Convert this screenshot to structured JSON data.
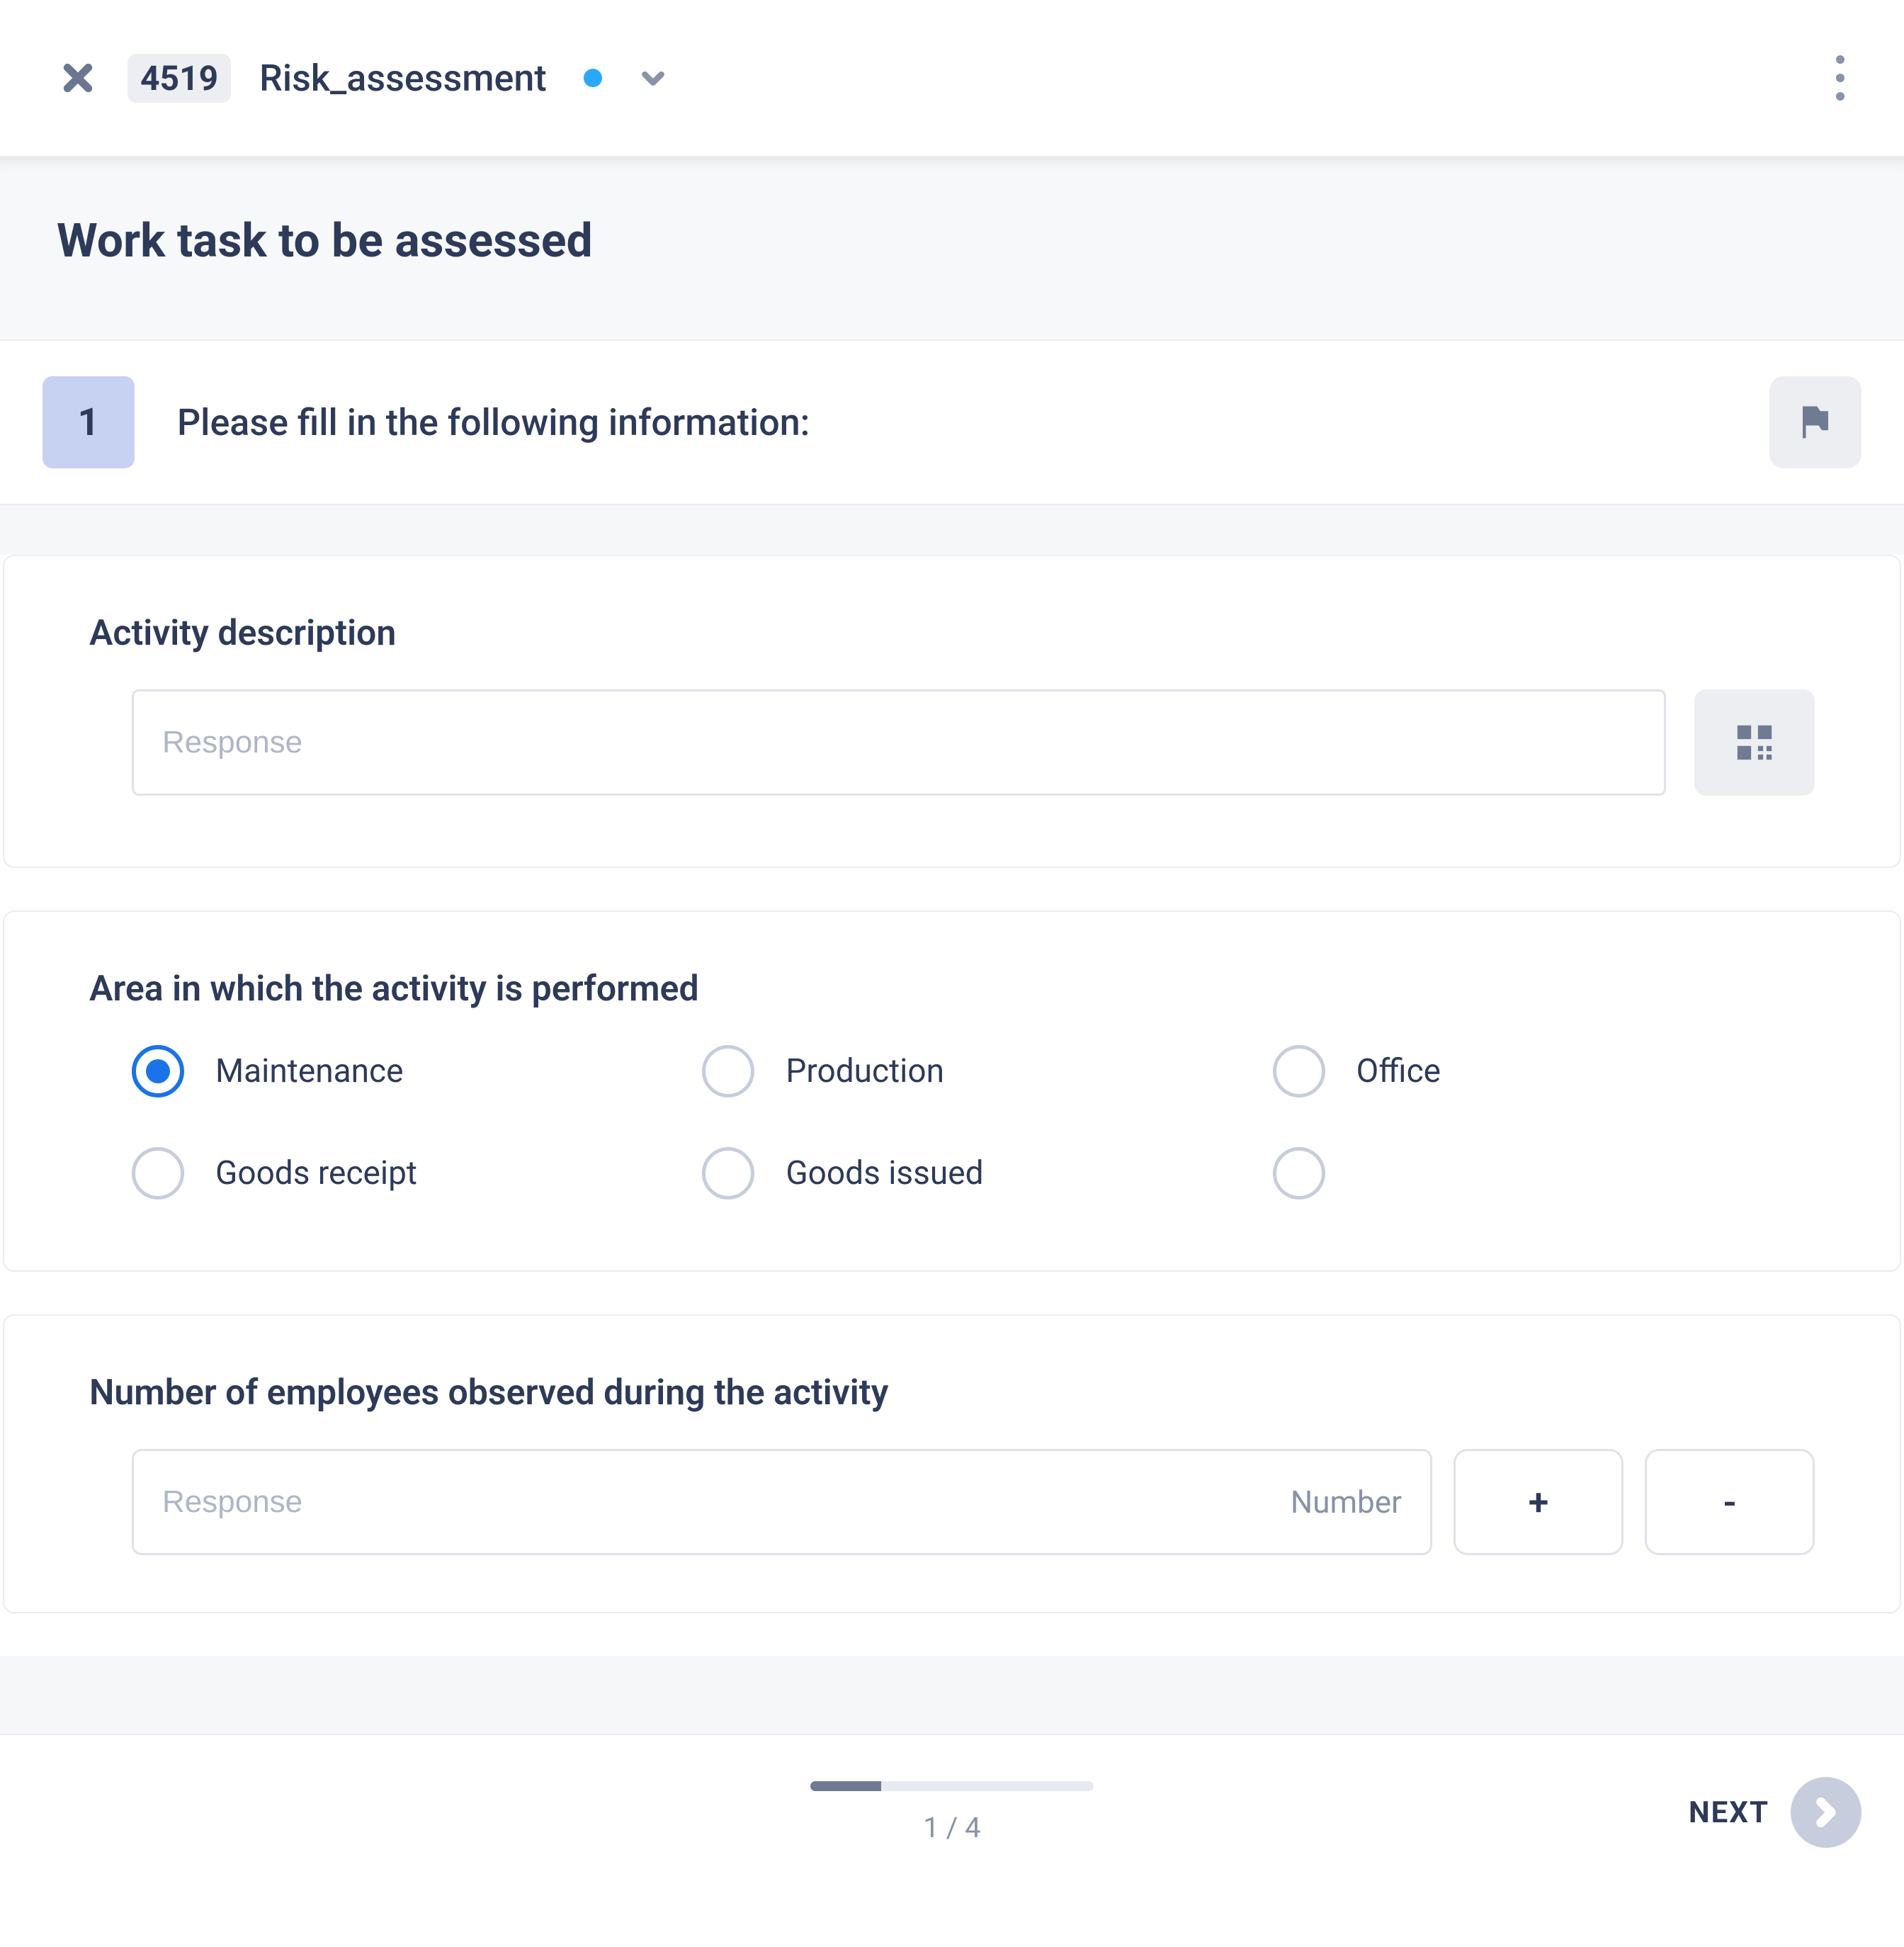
{
  "header": {
    "id_badge": "4519",
    "title": "Risk_assessment",
    "status_color": "#2aa7ff"
  },
  "section": {
    "heading": "Work task to be assessed"
  },
  "question": {
    "number": "1",
    "prompt": "Please fill in the following information:"
  },
  "fields": {
    "activity": {
      "label": "Activity description",
      "placeholder": "Response"
    },
    "area": {
      "label": "Area in which the activity is performed",
      "options": [
        "Maintenance",
        "Production",
        "Office",
        "Goods receipt",
        "Goods issued",
        ""
      ],
      "selected_index": 0
    },
    "employees": {
      "label": "Number of employees observed during the activity",
      "placeholder": "Response",
      "hint": "Number",
      "plus": "+",
      "minus": "-"
    }
  },
  "footer": {
    "progress_fraction": 0.25,
    "progress_text": "1 / 4",
    "next_label": "NEXT"
  }
}
